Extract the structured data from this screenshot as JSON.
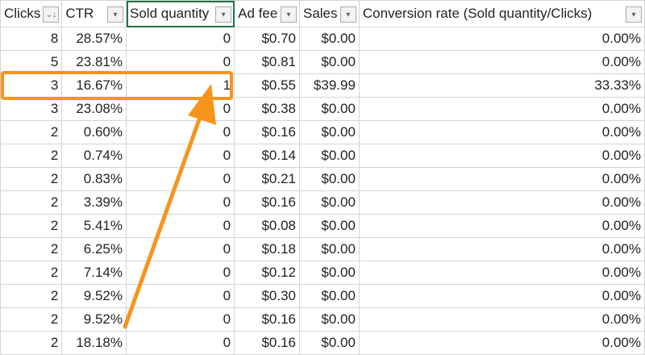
{
  "columns": [
    {
      "label": "Clicks",
      "filter_icon": "sort-desc-filter-icon"
    },
    {
      "label": "CTR",
      "filter_icon": "filter-dropdown-icon"
    },
    {
      "label": "Sold quantity",
      "filter_icon": "filter-dropdown-icon"
    },
    {
      "label": "Ad fee",
      "filter_icon": "filter-dropdown-icon"
    },
    {
      "label": "Sales",
      "filter_icon": "filter-dropdown-icon"
    },
    {
      "label": "Conversion rate (Sold quantity/Clicks)",
      "filter_icon": "filter-dropdown-icon"
    }
  ],
  "rows": [
    [
      "8",
      "28.57%",
      "0",
      "$0.70",
      "$0.00",
      "0.00%"
    ],
    [
      "5",
      "23.81%",
      "0",
      "$0.81",
      "$0.00",
      "0.00%"
    ],
    [
      "3",
      "16.67%",
      "1",
      "$0.55",
      "$39.99",
      "33.33%"
    ],
    [
      "3",
      "23.08%",
      "0",
      "$0.38",
      "$0.00",
      "0.00%"
    ],
    [
      "2",
      "0.60%",
      "0",
      "$0.16",
      "$0.00",
      "0.00%"
    ],
    [
      "2",
      "0.74%",
      "0",
      "$0.14",
      "$0.00",
      "0.00%"
    ],
    [
      "2",
      "0.83%",
      "0",
      "$0.21",
      "$0.00",
      "0.00%"
    ],
    [
      "2",
      "3.39%",
      "0",
      "$0.16",
      "$0.00",
      "0.00%"
    ],
    [
      "2",
      "5.41%",
      "0",
      "$0.08",
      "$0.00",
      "0.00%"
    ],
    [
      "2",
      "6.25%",
      "0",
      "$0.18",
      "$0.00",
      "0.00%"
    ],
    [
      "2",
      "7.14%",
      "0",
      "$0.12",
      "$0.00",
      "0.00%"
    ],
    [
      "2",
      "9.52%",
      "0",
      "$0.30",
      "$0.00",
      "0.00%"
    ],
    [
      "2",
      "9.52%",
      "0",
      "$0.16",
      "$0.00",
      "0.00%"
    ],
    [
      "2",
      "18.18%",
      "0",
      "$0.16",
      "$0.00",
      "0.00%"
    ]
  ],
  "highlight": {
    "row": 3,
    "color": "#f7941d"
  },
  "selected_header": "Sold quantity"
}
